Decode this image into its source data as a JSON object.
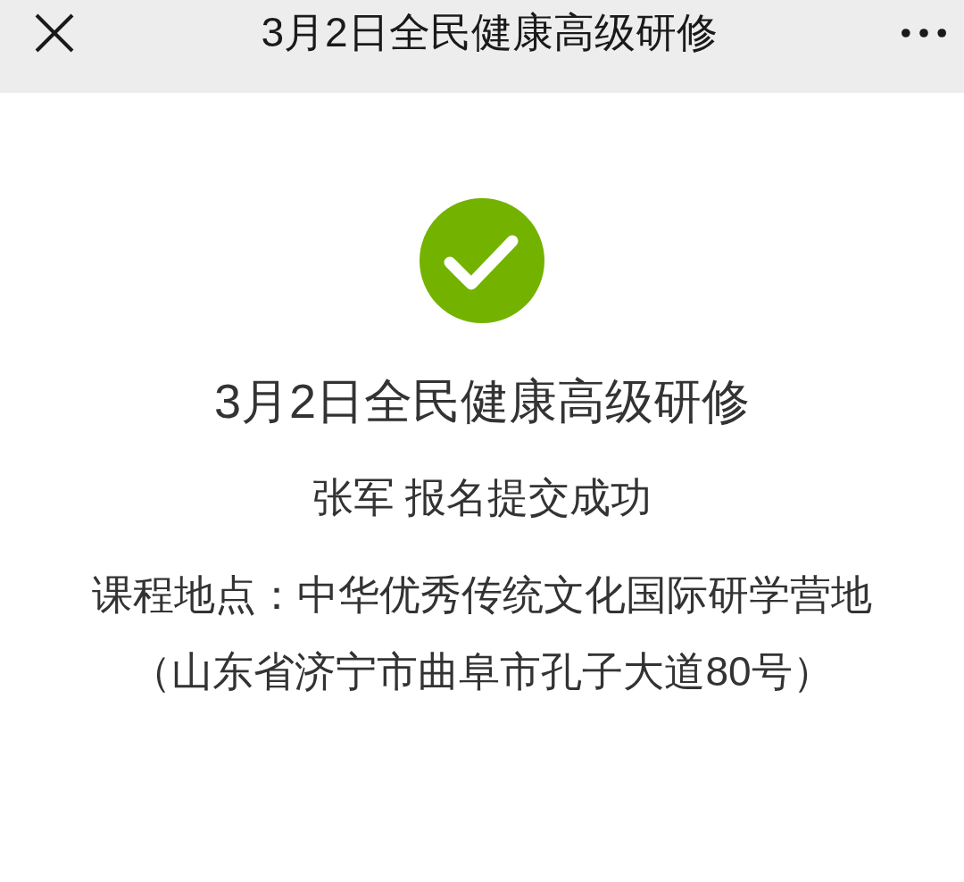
{
  "header": {
    "title": "3月2日全民健康高级研修"
  },
  "result": {
    "success": true,
    "title": "3月2日全民健康高级研修",
    "message": "张军 报名提交成功",
    "location_lines": [
      "课程地点：中华优秀传统文化国际研学营地",
      "（山东省济宁市曲阜市孔子大道80号）"
    ]
  }
}
